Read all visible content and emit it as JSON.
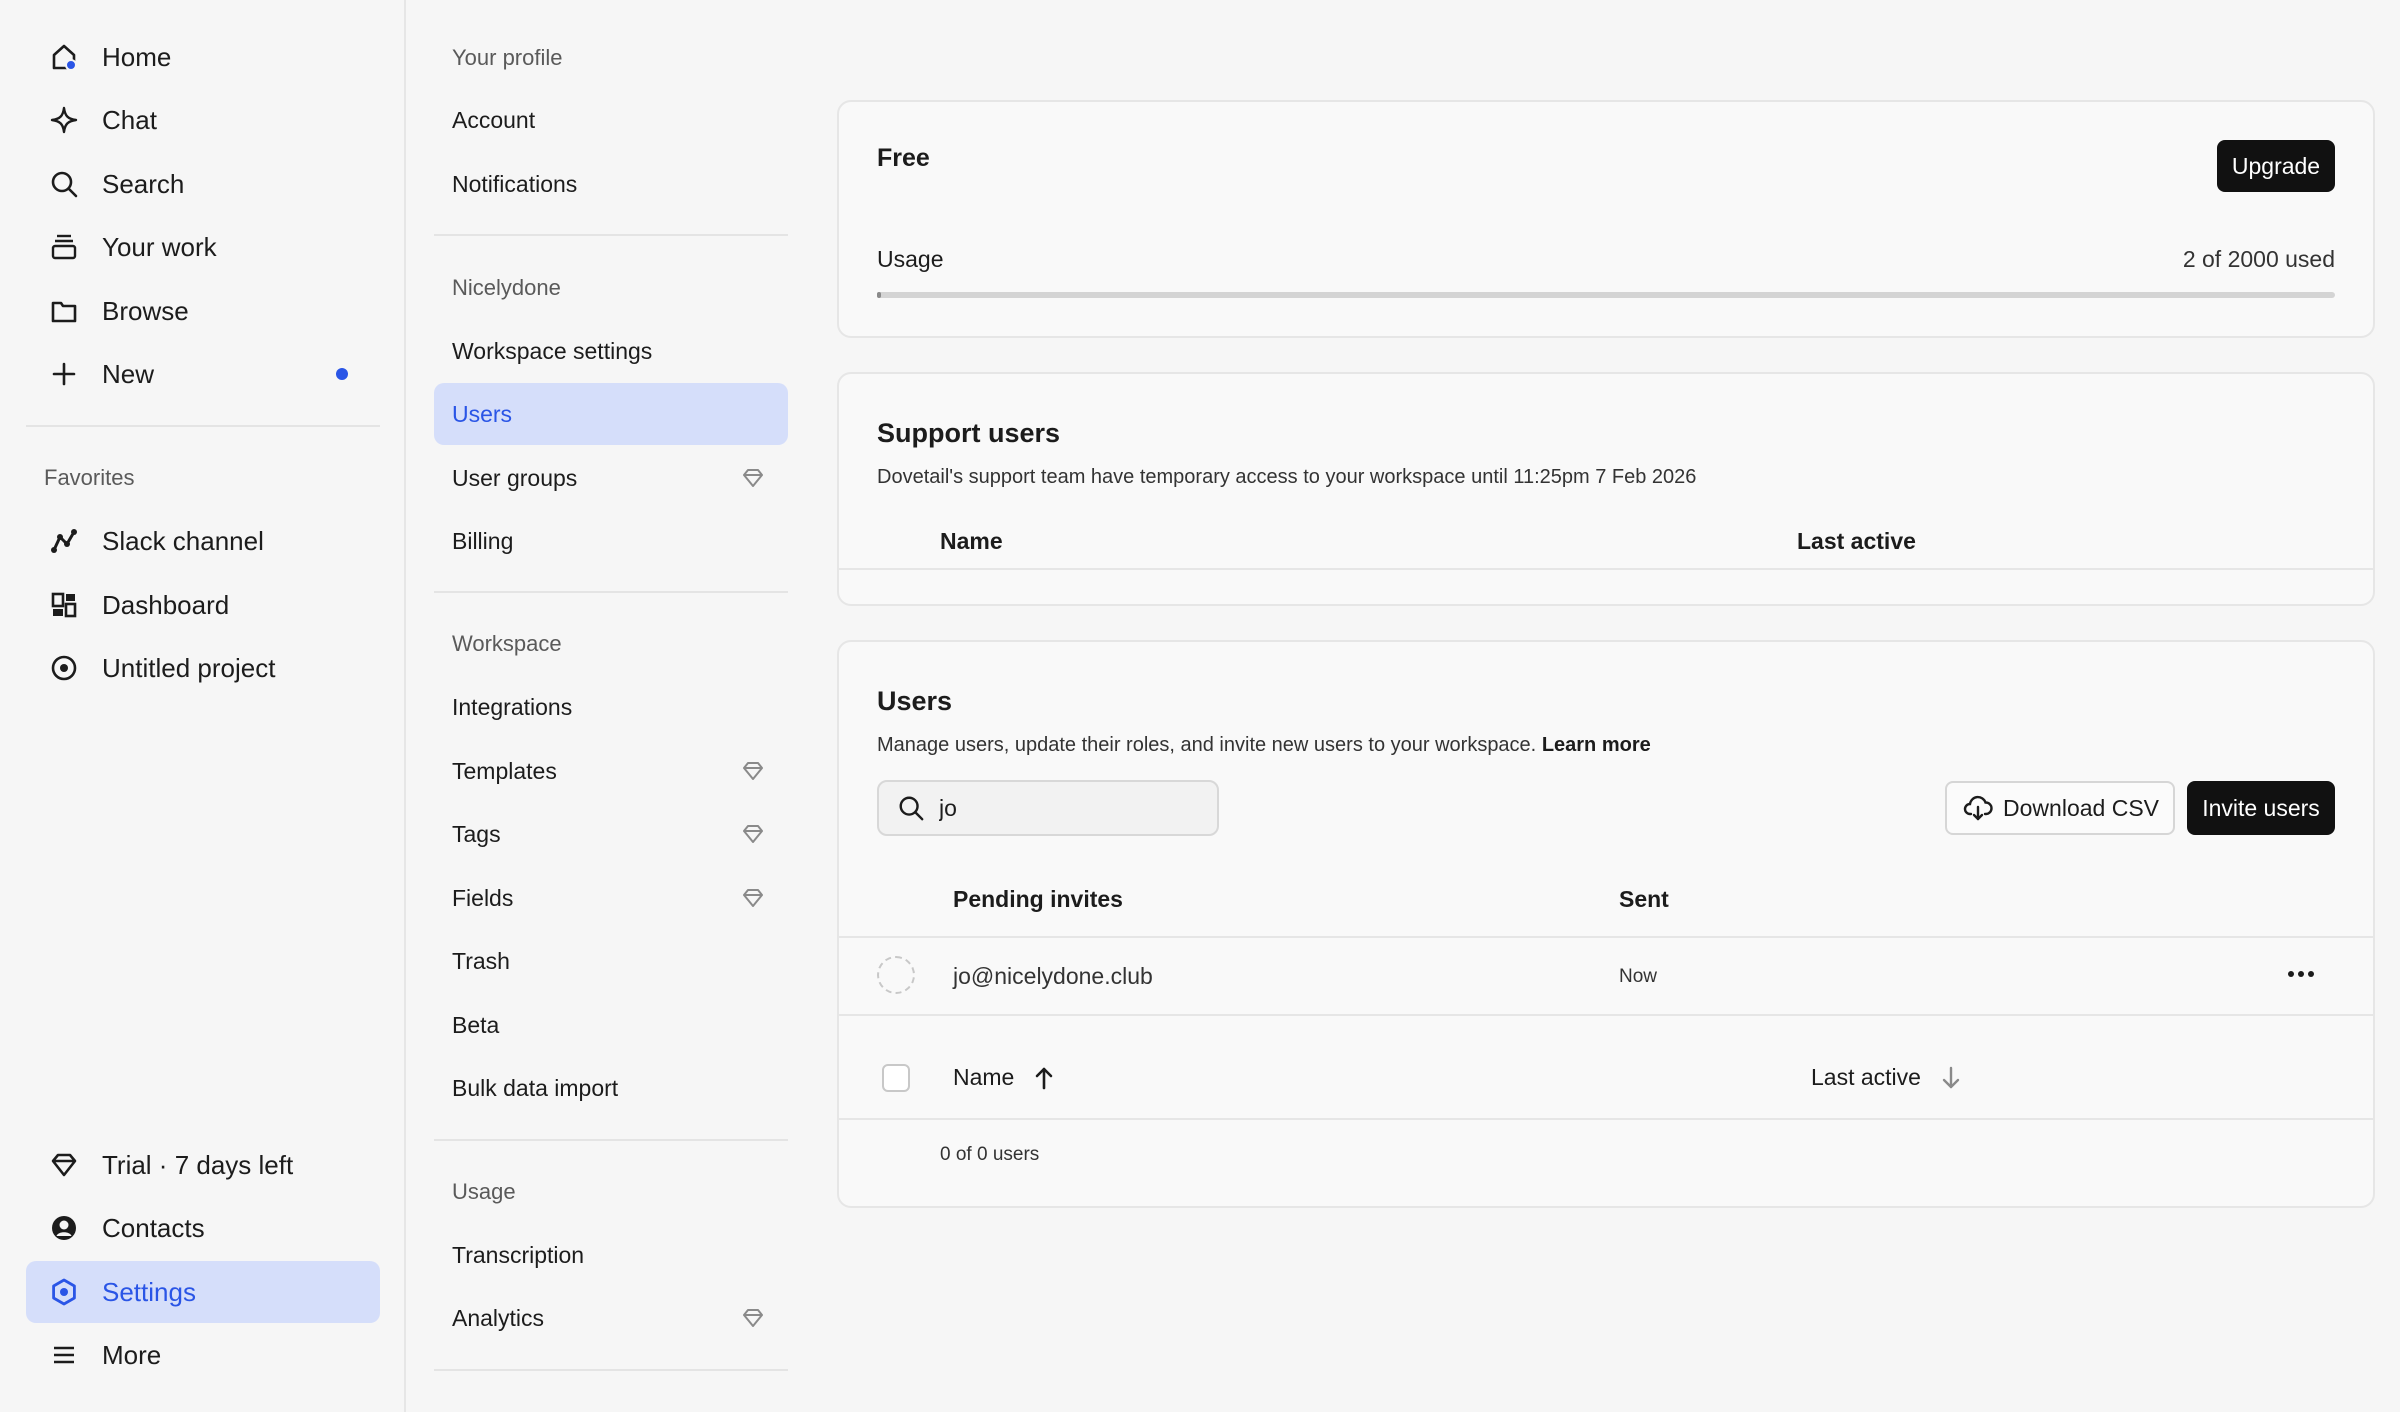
{
  "nav": {
    "items": [
      {
        "label": "Home",
        "icon": "home-icon"
      },
      {
        "label": "Chat",
        "icon": "sparkle-icon"
      },
      {
        "label": "Search",
        "icon": "search-icon"
      },
      {
        "label": "Your work",
        "icon": "stack-icon"
      },
      {
        "label": "Browse",
        "icon": "folder-icon"
      },
      {
        "label": "New",
        "icon": "plus-icon"
      }
    ],
    "favorites_title": "Favorites",
    "favorites": [
      {
        "label": "Slack channel",
        "icon": "chart-line-icon"
      },
      {
        "label": "Dashboard",
        "icon": "dashboard-icon"
      },
      {
        "label": "Untitled project",
        "icon": "compass-icon"
      }
    ],
    "bottom": [
      {
        "label": "Trial · 7 days left",
        "icon": "diamond-icon"
      },
      {
        "label": "Contacts",
        "icon": "user-circle-icon"
      },
      {
        "label": "Settings",
        "icon": "settings-hex-icon"
      },
      {
        "label": "More",
        "icon": "menu-icon"
      }
    ],
    "accent": "#2a55e6"
  },
  "settings_nav": {
    "groups": [
      {
        "title": "Your profile",
        "items": [
          {
            "label": "Account"
          },
          {
            "label": "Notifications"
          }
        ]
      },
      {
        "title": "Nicelydone",
        "items": [
          {
            "label": "Workspace settings"
          },
          {
            "label": "Users"
          },
          {
            "label": "User groups"
          },
          {
            "label": "Billing"
          }
        ]
      },
      {
        "title": "Workspace",
        "items": [
          {
            "label": "Integrations"
          },
          {
            "label": "Templates"
          },
          {
            "label": "Tags"
          },
          {
            "label": "Fields"
          },
          {
            "label": "Trash"
          },
          {
            "label": "Beta"
          },
          {
            "label": "Bulk data import"
          }
        ]
      },
      {
        "title": "Usage",
        "items": [
          {
            "label": "Transcription"
          },
          {
            "label": "Analytics"
          }
        ]
      }
    ]
  },
  "plan": {
    "title": "Free",
    "upgrade_label": "Upgrade",
    "usage_label": "Usage",
    "usage_value": "2 of 2000 used",
    "usage_fraction": 0.001
  },
  "support": {
    "title": "Support users",
    "description": "Dovetail's support team have temporary access to your workspace until 11:25pm 7 Feb 2026",
    "col_name": "Name",
    "col_last_active": "Last active"
  },
  "users": {
    "title": "Users",
    "description": "Manage users, update their roles, and invite new users to your workspace.",
    "learn_more": "Learn more",
    "search_value": "jo",
    "download_csv_label": "Download CSV",
    "invite_label": "Invite users",
    "pending_header": "Pending invites",
    "sent_header": "Sent",
    "pending": [
      {
        "email": "jo@nicelydone.club",
        "sent": "Now"
      }
    ],
    "col_name": "Name",
    "col_last_active": "Last active",
    "count_text": "0 of 0 users"
  }
}
